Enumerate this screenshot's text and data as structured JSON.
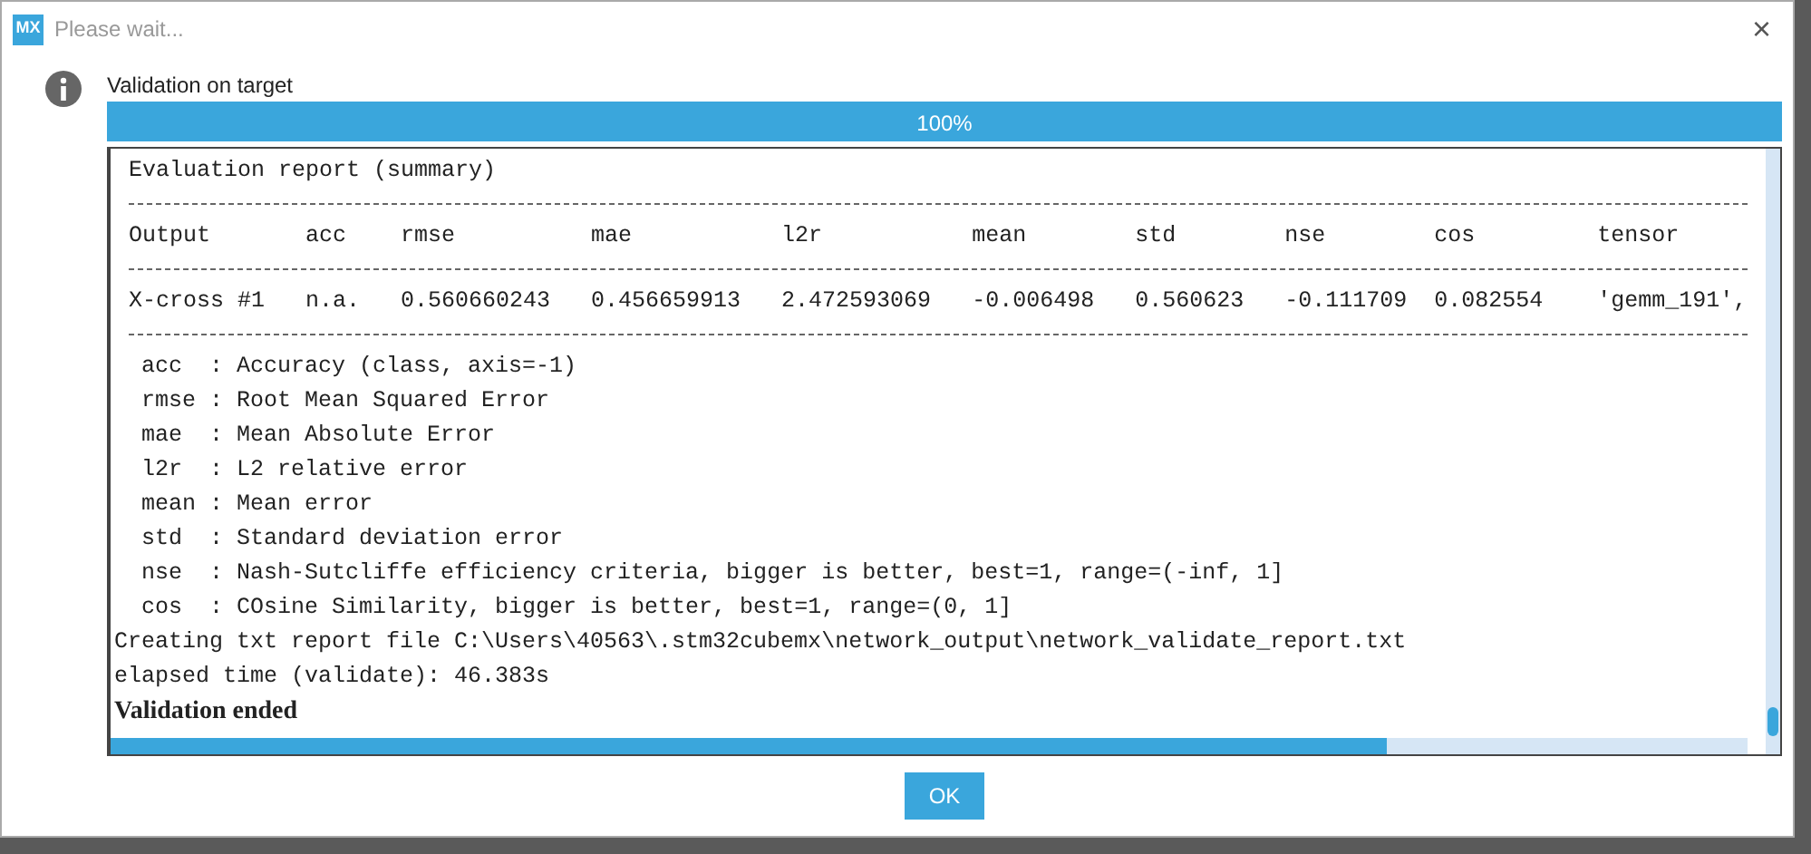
{
  "window": {
    "logo": "MX",
    "title": "Please wait...",
    "close": "×"
  },
  "message": "Validation on target",
  "progress": {
    "level": 1,
    "label": "100%"
  },
  "console": {
    "heading": "Evaluation report (summary)",
    "columns": [
      "Output",
      "acc",
      "rmse",
      "mae",
      "l2r",
      "mean",
      "std",
      "nse",
      "cos",
      "tensor"
    ],
    "rows": [
      [
        "X-cross #1",
        "n.a.",
        "0.560660243",
        "0.456659913",
        "2.472593069",
        "-0.006498",
        "0.560623",
        "-0.111709",
        "0.082554",
        "'gemm_191',"
      ]
    ],
    "legend": [
      {
        "key": "acc",
        "separator": ":",
        "text": "Accuracy (class, axis=-1)"
      },
      {
        "key": "rmse",
        "separator": ":",
        "text": "Root Mean Squared Error"
      },
      {
        "key": "mae",
        "separator": ":",
        "text": "Mean Absolute Error"
      },
      {
        "key": "l2r",
        "separator": ":",
        "text": "L2 relative error"
      },
      {
        "key": "mean",
        "separator": ":",
        "text": "Mean error"
      },
      {
        "key": "std",
        "separator": ":",
        "text": "Standard deviation error"
      },
      {
        "key": "nse",
        "separator": ":",
        "text": "Nash-Sutcliffe efficiency criteria, bigger is better, best=1, range=(-inf, 1]"
      },
      {
        "key": "cos",
        "separator": ":",
        "text": "COsine Similarity, bigger is better, best=1, range=(0, 1]"
      }
    ],
    "lines": [
      {
        "kind": "plain",
        "text": "Creating txt report file C:\\Users\\40563\\.stm32cubemx\\network_output\\network_validate_report.txt"
      },
      {
        "kind": "plain",
        "text": "elapsed time (validate): 46.383s"
      },
      {
        "kind": "bold",
        "text": "Validation ended"
      }
    ]
  },
  "ok_button": "OK"
}
